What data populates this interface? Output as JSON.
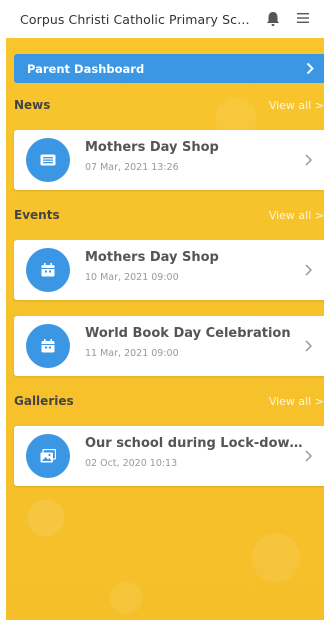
{
  "header": {
    "title": "Corpus Christi Catholic Primary School",
    "bell_icon": "bell-icon",
    "menu_icon": "hamburger-menu-icon"
  },
  "parent_dashboard": {
    "label": "Parent Dashboard"
  },
  "sections": {
    "news": {
      "title": "News",
      "view_all": "View all >",
      "items": [
        {
          "title": "Mothers Day Shop",
          "date": "07 Mar, 2021 13:26",
          "icon": "newspaper-icon"
        }
      ]
    },
    "events": {
      "title": "Events",
      "view_all": "View all >",
      "items": [
        {
          "title": "Mothers Day Shop",
          "date": "10 Mar, 2021 09:00",
          "icon": "calendar-icon"
        },
        {
          "title": "World Book Day Celebration",
          "date": "11 Mar, 2021 09:00",
          "icon": "calendar-icon"
        }
      ]
    },
    "galleries": {
      "title": "Galleries",
      "view_all": "View all >",
      "items": [
        {
          "title": "Our school during Lock-down ...",
          "date": "02 Oct, 2020 10:13",
          "icon": "photo-gallery-icon"
        }
      ]
    }
  },
  "colors": {
    "accent": "#3b97e3",
    "background": "#f6c22d",
    "card": "#ffffff"
  }
}
